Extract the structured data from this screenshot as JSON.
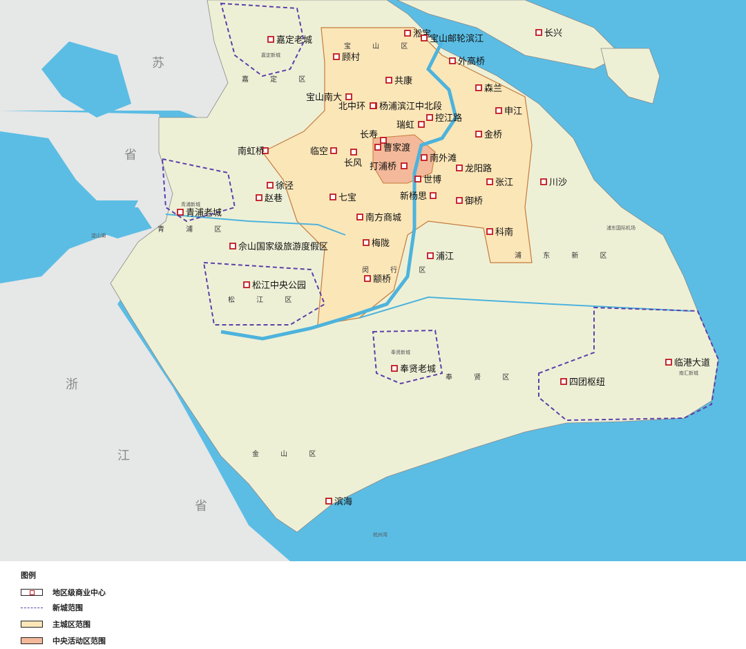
{
  "provinces": {
    "jiangsu": [
      "苏",
      "省"
    ],
    "zhejiang": [
      "浙",
      "江",
      "省"
    ]
  },
  "districts": {
    "baoshan": "宝 山 区",
    "jiading": "嘉 定 区",
    "qingpu": "青 浦 区",
    "songjiang": "松 江 区",
    "minhang": "闵 行 区",
    "pudong": "浦 东 新 区",
    "fengxian": "奉 贤 区",
    "jinshan": "金 山 区"
  },
  "small_labels": {
    "jiading_newcity": "嘉定新城",
    "qingpu_newcity": "青浦新城",
    "fengxian_newcity": "奉贤新城",
    "nanhui_newcity": "南汇新城",
    "airport": "浦东国际机场",
    "dianshan_lake": "淀山湖",
    "hangzhou_bay": "杭州湾"
  },
  "centers": [
    {
      "name": "嘉定老城"
    },
    {
      "name": "淞宝"
    },
    {
      "name": "宝山邮轮滨江"
    },
    {
      "name": "长兴"
    },
    {
      "name": "顾村"
    },
    {
      "name": "外高桥"
    },
    {
      "name": "共康"
    },
    {
      "name": "森兰"
    },
    {
      "name": "宝山南大"
    },
    {
      "name": "杨浦滨江中北段"
    },
    {
      "name": "北中环"
    },
    {
      "name": "申江"
    },
    {
      "name": "瑞虹"
    },
    {
      "name": "控江路"
    },
    {
      "name": "金桥"
    },
    {
      "name": "长寿"
    },
    {
      "name": "南虹桥"
    },
    {
      "name": "临空"
    },
    {
      "name": "曹家渡"
    },
    {
      "name": "长风"
    },
    {
      "name": "南外滩"
    },
    {
      "name": "打浦桥"
    },
    {
      "name": "龙阳路"
    },
    {
      "name": "徐泾"
    },
    {
      "name": "世博"
    },
    {
      "name": "张江"
    },
    {
      "name": "川沙"
    },
    {
      "name": "赵巷"
    },
    {
      "name": "七宝"
    },
    {
      "name": "新杨思"
    },
    {
      "name": "御桥"
    },
    {
      "name": "青浦老城"
    },
    {
      "name": "南方商城"
    },
    {
      "name": "科南"
    },
    {
      "name": "梅陇"
    },
    {
      "name": "佘山国家级旅游度假区"
    },
    {
      "name": "浦江"
    },
    {
      "name": "颛桥"
    },
    {
      "name": "松江中央公园"
    },
    {
      "name": "临港大道"
    },
    {
      "name": "奉贤老城"
    },
    {
      "name": "四团枢纽"
    },
    {
      "name": "滨海"
    }
  ],
  "legend": {
    "title": "图例",
    "items": [
      {
        "label": "地区级商业中心"
      },
      {
        "label": "新城范围"
      },
      {
        "label": "主城区范围"
      },
      {
        "label": "中央活动区范围"
      }
    ]
  },
  "colors": {
    "sea": "#5bbde4",
    "land": "#eef0d6",
    "outside": "#e6e7e7",
    "main_city": "#fbe6b8",
    "cbd": "#f3b99a",
    "newcity_border": "#5b3fa8",
    "marker": "#c0161f",
    "river": "#4db3dc"
  }
}
